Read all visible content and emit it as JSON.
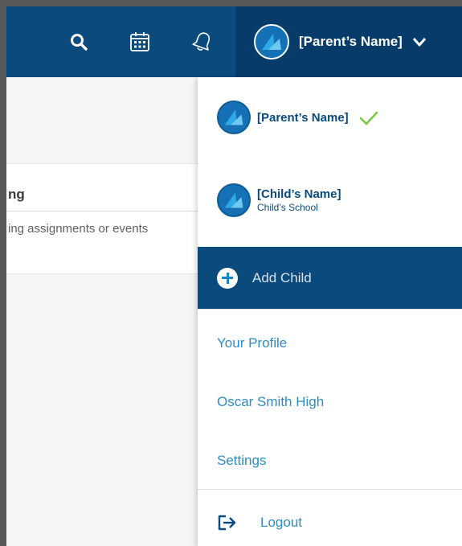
{
  "header": {
    "search_icon": "search-icon",
    "calendar_icon": "calendar-icon",
    "notification_icon": "bell-icon",
    "user_name": "[Parent’s Name]",
    "dropdown_icon": "chevron-down-icon",
    "background_color": "#0a4a7d"
  },
  "background_card": {
    "title": "ng",
    "body": "ing assignments or events"
  },
  "dropdown": {
    "accounts": [
      {
        "name": "[Parent’s Name]",
        "subtitle": "",
        "selected": true
      },
      {
        "name": "[Child’s Name]",
        "subtitle": "Child’s School",
        "selected": false
      }
    ],
    "add_child_label": "Add Child",
    "links": [
      {
        "label": "Your Profile"
      },
      {
        "label": "Oscar Smith High"
      },
      {
        "label": "Settings"
      }
    ],
    "logout_label": "Logout",
    "accent_color": "#2c8dc5",
    "check_color": "#7ac943"
  }
}
